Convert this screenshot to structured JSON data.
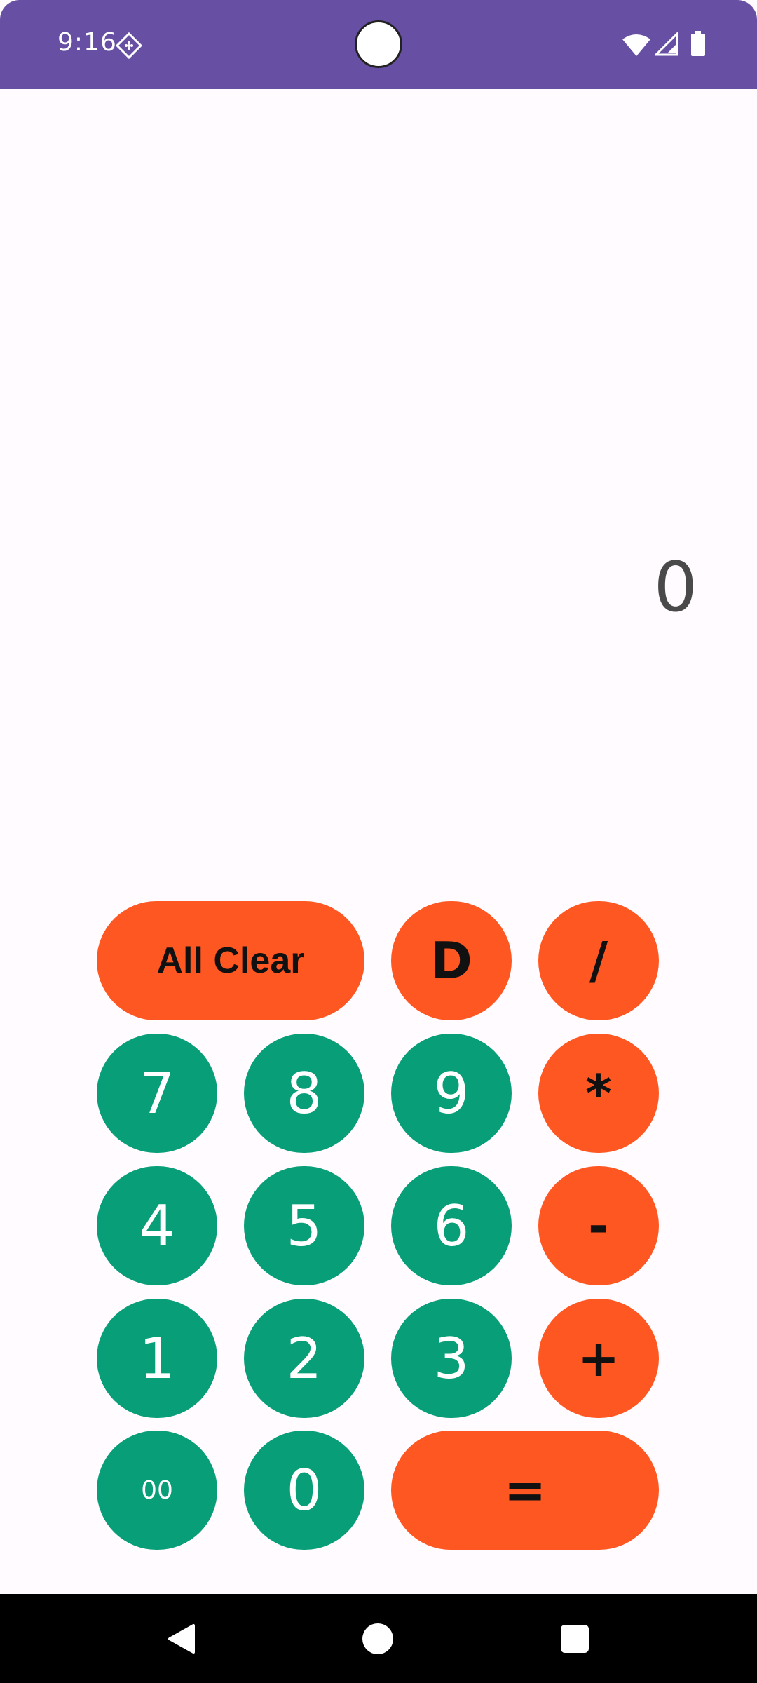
{
  "status_bar": {
    "time": "9:16",
    "color": "#6750a4"
  },
  "display": {
    "value": "0"
  },
  "keys": {
    "all_clear": "All Clear",
    "delete": "D",
    "divide": "/",
    "seven": "7",
    "eight": "8",
    "nine": "9",
    "multiply": "*",
    "four": "4",
    "five": "5",
    "six": "6",
    "minus": "-",
    "one": "1",
    "two": "2",
    "three": "3",
    "plus": "+",
    "double_zero": "00",
    "zero": "0",
    "equals": "="
  },
  "colors": {
    "number_key": "#089e78",
    "operator_key": "#ff5722",
    "background": "#fffbfe"
  },
  "nav_bar": {
    "icons": [
      "back-icon",
      "home-icon",
      "recents-icon"
    ]
  }
}
